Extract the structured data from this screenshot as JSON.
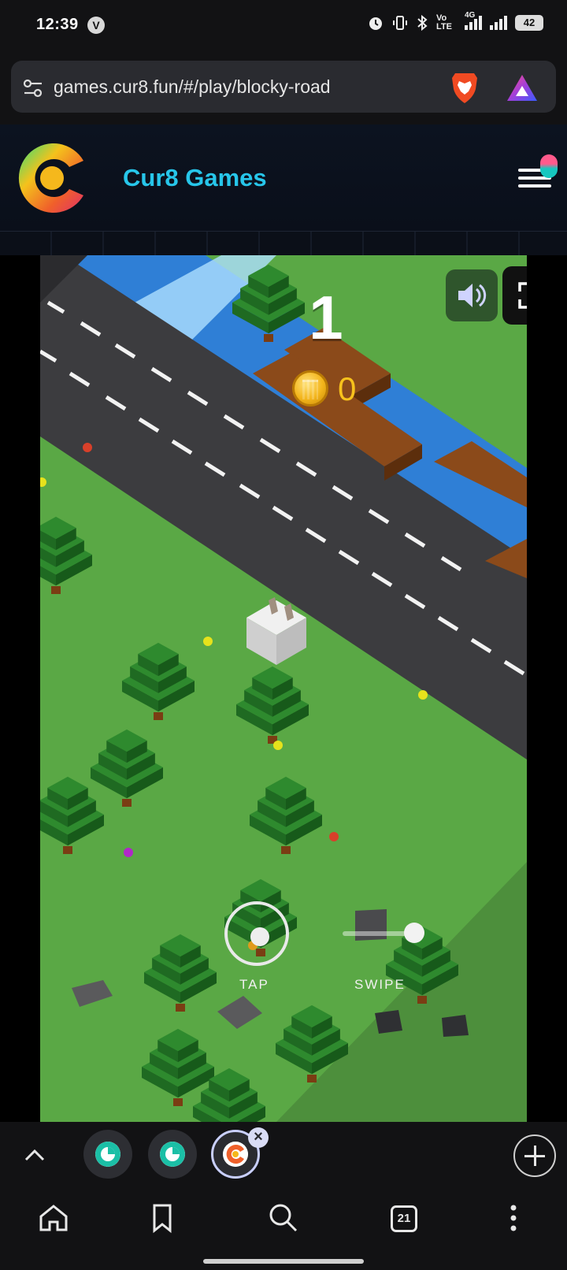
{
  "status_bar": {
    "time": "12:39",
    "vpn_badge": "V",
    "network": "Vo LTE",
    "network_gen": "4G",
    "battery": "42"
  },
  "browser": {
    "url": "games.cur8.fun/#/play/blocky-road",
    "brand_icon": "brave-lion-icon",
    "rewards_icon": "brave-rewards-icon"
  },
  "site": {
    "title": "Cur8 Games",
    "logo_icon": "cur8-logo-icon",
    "menu_icon": "hamburger-menu-icon"
  },
  "game": {
    "name": "blocky-road",
    "score": "1",
    "coins": "0",
    "sound_icon": "speaker-icon",
    "fullscreen_icon": "fullscreen-icon",
    "hint_tap": "TAP",
    "hint_swipe": "SWIPE"
  },
  "tabs": {
    "open_count": "21",
    "thumbnails": [
      "tab-1",
      "tab-2",
      "tab-3-active"
    ]
  },
  "colors": {
    "accent": "#27c6ea",
    "coin": "#f7c21c",
    "grass": "#5aa845",
    "road": "#3c3c3f",
    "water": "#2f7fd6",
    "log": "#7a3d13",
    "tree": "#2e8a2e"
  }
}
